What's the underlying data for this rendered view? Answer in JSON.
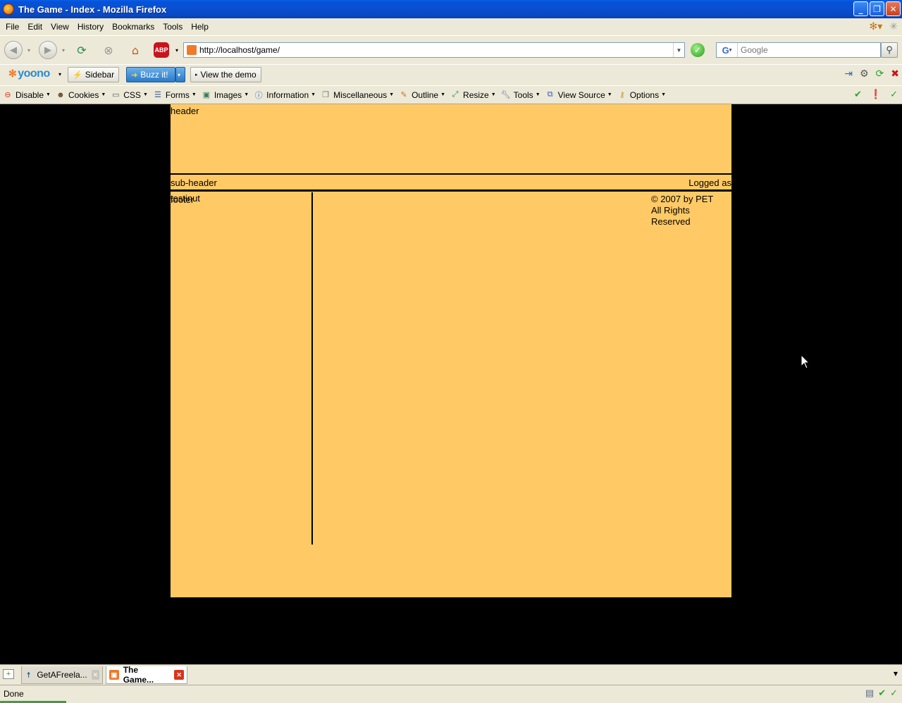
{
  "window": {
    "title": "The Game - Index - Mozilla Firefox",
    "buttons": {
      "minimize": "_",
      "maximize": "❐",
      "close": "✕"
    }
  },
  "menu": {
    "items": [
      "File",
      "Edit",
      "View",
      "History",
      "Bookmarks",
      "Tools",
      "Help"
    ]
  },
  "nav": {
    "url": "http://localhost/game/",
    "search_placeholder": "Google",
    "search_engine_glyph": "G",
    "abp_label": "ABP"
  },
  "yoono": {
    "logo": "yoono",
    "sidebar_label": "Sidebar",
    "buzz_label": "Buzz it!",
    "demo_label": "View the demo"
  },
  "devtools": {
    "items": [
      "Disable",
      "Cookies",
      "CSS",
      "Forms",
      "Images",
      "Information",
      "Miscellaneous",
      "Outline",
      "Resize",
      "Tools",
      "View Source",
      "Options"
    ]
  },
  "page": {
    "header": "header",
    "subheader_left": "sub-header",
    "subheader_right": "Logged as",
    "leftcol_text_1": "testinut",
    "leftcol_text_2": "footer",
    "footer_line1": "© 2007 by PET",
    "footer_line2": "All Rights Reserved",
    "background_color": "#FFCA66",
    "outer_background": "#000000"
  },
  "tabs": [
    {
      "label": "GetAFreela...",
      "active": false
    },
    {
      "label": "The Game...",
      "active": true
    }
  ],
  "status": {
    "text": "Done"
  }
}
